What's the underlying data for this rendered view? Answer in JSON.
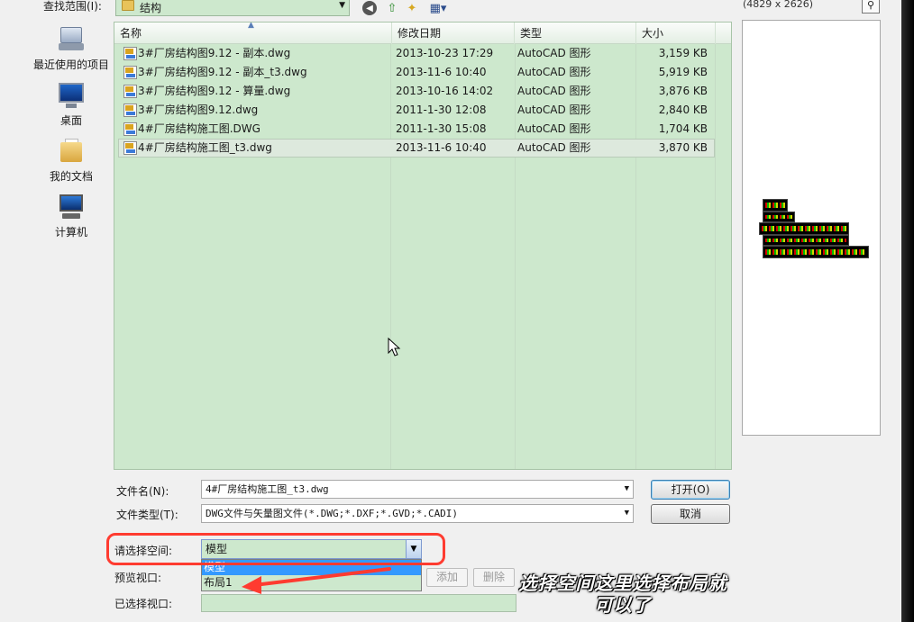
{
  "lookin": {
    "label": "查找范围(I):",
    "value": "结构"
  },
  "preview_size": "(4829 x 2626)",
  "places": [
    {
      "label": "最近使用的项目",
      "icon": "recent-items-icon"
    },
    {
      "label": "桌面",
      "icon": "desktop-icon"
    },
    {
      "label": "我的文档",
      "icon": "my-documents-icon"
    },
    {
      "label": "计算机",
      "icon": "computer-icon"
    }
  ],
  "columns": {
    "name": "名称",
    "modified": "修改日期",
    "type": "类型",
    "size": "大小"
  },
  "files": [
    {
      "name": "3#厂房结构图9.12 - 副本.dwg",
      "modified": "2013-10-23 17:29",
      "type": "AutoCAD 图形",
      "size": "3,159 KB"
    },
    {
      "name": "3#厂房结构图9.12 - 副本_t3.dwg",
      "modified": "2013-11-6 10:40",
      "type": "AutoCAD 图形",
      "size": "5,919 KB"
    },
    {
      "name": "3#厂房结构图9.12 - 算量.dwg",
      "modified": "2013-10-16 14:02",
      "type": "AutoCAD 图形",
      "size": "3,876 KB"
    },
    {
      "name": "3#厂房结构图9.12.dwg",
      "modified": "2011-1-30 12:08",
      "type": "AutoCAD 图形",
      "size": "2,840 KB"
    },
    {
      "name": "4#厂房结构施工图.DWG",
      "modified": "2011-1-30 15:08",
      "type": "AutoCAD 图形",
      "size": "1,704 KB"
    },
    {
      "name": "4#厂房结构施工图_t3.dwg",
      "modified": "2013-11-6 10:40",
      "type": "AutoCAD 图形",
      "size": "3,870 KB"
    }
  ],
  "form": {
    "filename_label": "文件名(N):",
    "filename_value": "4#厂房结构施工图_t3.dwg",
    "filetype_label": "文件类型(T):",
    "filetype_value": "DWG文件与矢量图文件(*.DWG;*.DXF;*.GVD;*.CADI)",
    "open_label": "打开(O)",
    "cancel_label": "取消",
    "space_label": "请选择空间:",
    "space_value": "模型",
    "space_options": [
      "模型",
      "布局1"
    ],
    "preview_vp_label": "预览视口:",
    "add_label": "添加",
    "delete_label": "删除",
    "selected_vp_label": "已选择视口:"
  },
  "annotation": {
    "line1": "选择空间这里选择布局就",
    "line2": "可以了"
  },
  "colors": {
    "highlight": "#ff3b30",
    "list_bg": "#cde8cd",
    "selection": "#3399ff"
  }
}
